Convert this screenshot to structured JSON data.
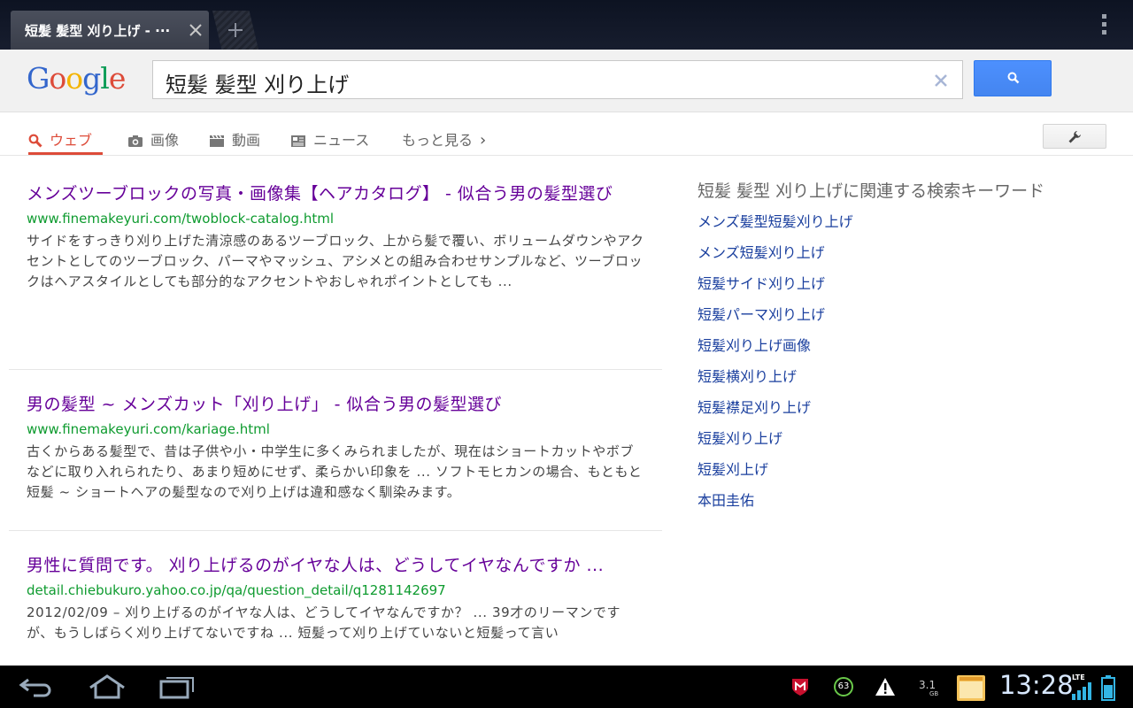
{
  "browser": {
    "tab_title": "短髪 髪型 刈り上げ - ···",
    "new_tab_symbol": "+"
  },
  "header": {
    "logo_letters": [
      "G",
      "o",
      "o",
      "g",
      "l",
      "e"
    ],
    "logo_colors": [
      "#3366cc",
      "#dd4b39",
      "#f4b400",
      "#3366cc",
      "#0f9d58",
      "#dd4b39"
    ],
    "search_query": "短髪 髪型 刈り上げ"
  },
  "nav": {
    "web": "ウェブ",
    "images": "画像",
    "video": "動画",
    "news": "ニュース",
    "more": "もっと見る",
    "more_chevron": "›"
  },
  "results": [
    {
      "title": "メンズツーブロックの写真・画像集【ヘアカタログ】 - 似合う男の髪型選び",
      "url": "www.finemakeyuri.com/twoblock-catalog.html",
      "snippet": "サイドをすっきり刈り上げた清涼感のあるツーブロック、上から髪で覆い、ボリュームダウンやアクセントとしてのツーブロック、パーマやマッシュ、アシメとの組み合わせサンプルなど、ツーブロックはヘアスタイルとしても部分的なアクセントやおしゃれポイントとしても ..."
    },
    {
      "title": "男の髪型 ~ メンズカット「刈り上げ」 - 似合う男の髪型選び",
      "url": "www.finemakeyuri.com/kariage.html",
      "snippet": "古くからある髪型で、昔は子供や小・中学生に多くみられましたが、現在はショートカットやボブなどに取り入れられたり、あまり短めにせず、柔らかい印象を ... ソフトモヒカンの場合、もともと短髪 ~ ショートヘアの髪型なので刈り上げは違和感なく馴染みます。"
    },
    {
      "title": "男性に質問です。 刈り上げるのがイヤな人は、どうしてイヤなんですか ...",
      "url": "detail.chiebukuro.yahoo.co.jp/qa/question_detail/q1281142697",
      "snippet": "2012/02/09 – 刈り上げるのがイヤな人は、どうしてイヤなんですか？ ... 39才のリーマンですが、もうしばらく刈り上げてないですね ... 短髪って刈り上げていないと短髪って言い"
    }
  ],
  "related": {
    "heading": "短髪 髪型 刈り上げに関連する検索キーワード",
    "items": [
      "メンズ髪型短髪刈り上げ",
      "メンズ短髪刈り上げ",
      "短髪サイド刈り上げ",
      "短髪パーマ刈り上げ",
      "短髪刈り上げ画像",
      "短髪横刈り上げ",
      "短髪襟足刈り上げ",
      "短髪刈り上げ",
      "短髪刈上げ",
      "本田圭佑"
    ]
  },
  "system_bar": {
    "clock": "13:28",
    "notification_count": "63",
    "storage_value": "3.1",
    "storage_unit": "GB",
    "network": "LTE",
    "accent": "#33b5e5"
  }
}
